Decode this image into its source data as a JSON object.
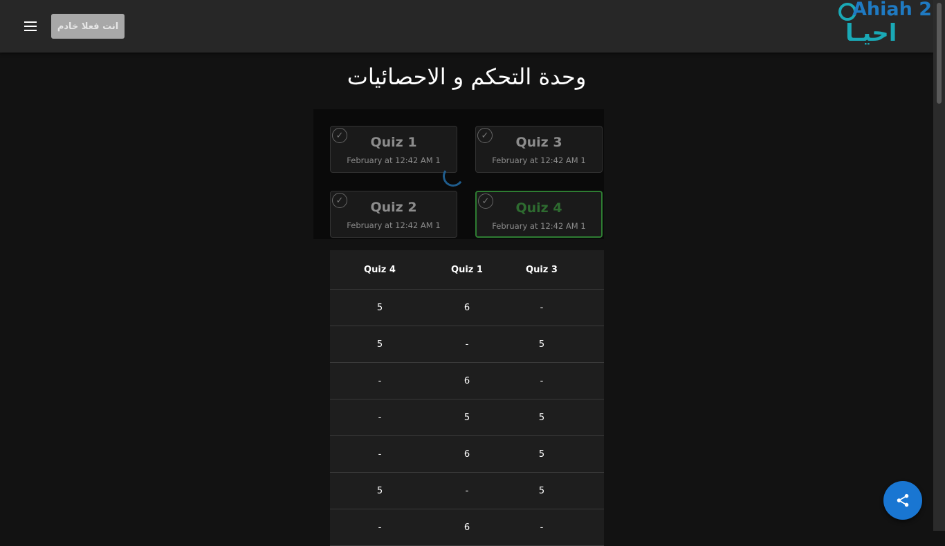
{
  "header": {
    "menu_icon": "menu-icon",
    "status_button": "انت فعلا خادم",
    "logo_en": "Ahiah 2",
    "logo_ar": "احيـا"
  },
  "page_title": "وحدة التحكم و الاحصائيات",
  "quizzes": [
    {
      "name": "Quiz 1",
      "date": "February at 12:42 AM 1",
      "selected": false
    },
    {
      "name": "Quiz 3",
      "date": "February at 12:42 AM 1",
      "selected": false
    },
    {
      "name": "Quiz 2",
      "date": "February at 12:42 AM 1",
      "selected": false
    },
    {
      "name": "Quiz 4",
      "date": "February at 12:42 AM 1",
      "selected": true
    }
  ],
  "table": {
    "headers": [
      "Quiz 4",
      "Quiz 1",
      "Quiz 3"
    ],
    "rows": [
      [
        "5",
        "6",
        "-"
      ],
      [
        "5",
        "-",
        "5"
      ],
      [
        "-",
        "6",
        "-"
      ],
      [
        "-",
        "5",
        "5"
      ],
      [
        "-",
        "6",
        "5"
      ],
      [
        "5",
        "-",
        "5"
      ],
      [
        "-",
        "6",
        "-"
      ]
    ]
  },
  "fab": {
    "icon": "share-icon"
  },
  "colors": {
    "selected": "#2e7d32",
    "accent": "#1976d2",
    "background": "#121212"
  }
}
